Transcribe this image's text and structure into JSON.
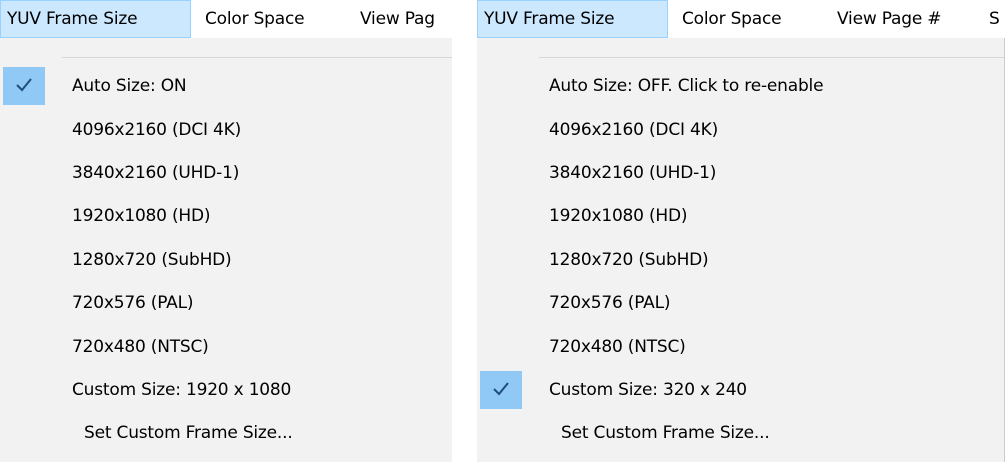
{
  "left_panel": {
    "menubar": [
      {
        "label": "YUV Frame Size",
        "active": true
      },
      {
        "label": "Color Space",
        "active": false
      },
      {
        "label": "View Pag",
        "active": false
      }
    ],
    "items": [
      {
        "label": "Auto Size: ON",
        "checked": true
      },
      {
        "label": "4096x2160 (DCI 4K)",
        "checked": false
      },
      {
        "label": "3840x2160 (UHD-1)",
        "checked": false
      },
      {
        "label": "1920x1080 (HD)",
        "checked": false
      },
      {
        "label": "1280x720 (SubHD)",
        "checked": false
      },
      {
        "label": "720x576 (PAL)",
        "checked": false
      },
      {
        "label": "720x480 (NTSC)",
        "checked": false
      },
      {
        "label": "Custom Size: 1920 x 1080",
        "checked": false
      },
      {
        "label": "Set Custom Frame Size...",
        "checked": false
      }
    ]
  },
  "right_panel": {
    "menubar": [
      {
        "label": "YUV Frame Size",
        "active": true
      },
      {
        "label": "Color Space",
        "active": false
      },
      {
        "label": "View Page #",
        "active": false
      },
      {
        "label": "S",
        "active": false
      }
    ],
    "items": [
      {
        "label": "Auto Size: OFF. Click to re-enable",
        "checked": false
      },
      {
        "label": "4096x2160 (DCI 4K)",
        "checked": false
      },
      {
        "label": "3840x2160 (UHD-1)",
        "checked": false
      },
      {
        "label": "1920x1080 (HD)",
        "checked": false
      },
      {
        "label": "1280x720 (SubHD)",
        "checked": false
      },
      {
        "label": "720x576 (PAL)",
        "checked": false
      },
      {
        "label": "720x480 (NTSC)",
        "checked": false
      },
      {
        "label": "Custom Size: 320 x 240",
        "checked": true
      },
      {
        "label": "Set Custom Frame Size...",
        "checked": false
      }
    ]
  },
  "colors": {
    "menubar_active_bg": "#cce8ff",
    "menubar_active_border": "#99d1ff",
    "dropdown_bg": "#f2f2f2",
    "check_bg": "#90c8f6",
    "check_mark": "#1f4e79"
  },
  "icons": {
    "check": "checkmark-icon"
  }
}
